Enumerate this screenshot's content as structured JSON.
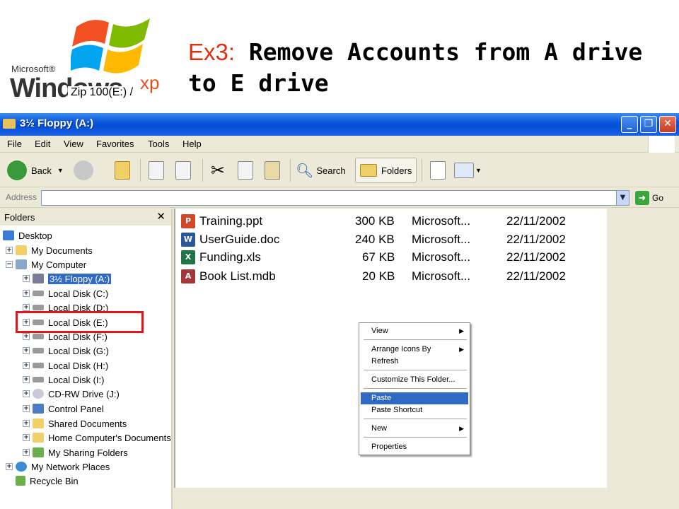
{
  "slide": {
    "logo_microsoft": "Microsoft®",
    "logo_windows": "Windows",
    "logo_xp": "xp",
    "title_prefix": "Ex3:",
    "title_text": "Remove Accounts from A drive to E drive"
  },
  "window": {
    "title": "3½ Floppy (A:)",
    "buttons": {
      "minimize": "_",
      "maximize": "❐",
      "close": "✕"
    }
  },
  "menubar": [
    "File",
    "Edit",
    "View",
    "Favorites",
    "Tools",
    "Help"
  ],
  "toolbar": {
    "back": "Back",
    "search": "Search",
    "folders": "Folders"
  },
  "address": {
    "label": "Address",
    "go": "Go",
    "overlay_text": "Zip 100(E:) /"
  },
  "folders_pane": {
    "title": "Folders",
    "close": "✕",
    "items": [
      {
        "label": "Desktop"
      },
      {
        "label": "My Documents"
      },
      {
        "label": "My Computer"
      },
      {
        "label": "3½ Floppy (A:)"
      },
      {
        "label": "Local Disk (C:)"
      },
      {
        "label": "Local Disk (D:)"
      },
      {
        "label": "Local Disk (E:)"
      },
      {
        "label": "Local Disk (F:)"
      },
      {
        "label": "Local Disk (G:)"
      },
      {
        "label": "Local Disk (H:)"
      },
      {
        "label": "Local Disk (I:)"
      },
      {
        "label": "CD-RW Drive (J:)"
      },
      {
        "label": "Control Panel"
      },
      {
        "label": "Shared Documents"
      },
      {
        "label": "Home Computer's Documents"
      },
      {
        "label": "My Sharing Folders"
      },
      {
        "label": "My Network Places"
      },
      {
        "label": "Recycle Bin"
      }
    ]
  },
  "files": [
    {
      "name": "Training.ppt",
      "size": "300 KB",
      "type": "Microsoft...",
      "date": "22/11/2002",
      "icon": "powerpoint-icon"
    },
    {
      "name": "UserGuide.doc",
      "size": "240 KB",
      "type": "Microsoft...",
      "date": "22/11/2002",
      "icon": "word-icon"
    },
    {
      "name": "Funding.xls",
      "size": "67 KB",
      "type": "Microsoft...",
      "date": "22/11/2002",
      "icon": "excel-icon"
    },
    {
      "name": "Book List.mdb",
      "size": "20 KB",
      "type": "Microsoft...",
      "date": "22/11/2002",
      "icon": "access-icon"
    }
  ],
  "context_menu": {
    "view": "View",
    "arrange": "Arrange Icons By",
    "refresh": "Refresh",
    "customize": "Customize This Folder...",
    "paste": "Paste",
    "paste_shortcut": "Paste Shortcut",
    "new": "New",
    "properties": "Properties"
  },
  "colors": {
    "highlight_box": "#e0161b",
    "selection": "#316ac5",
    "titlebar": "#0650d8"
  }
}
